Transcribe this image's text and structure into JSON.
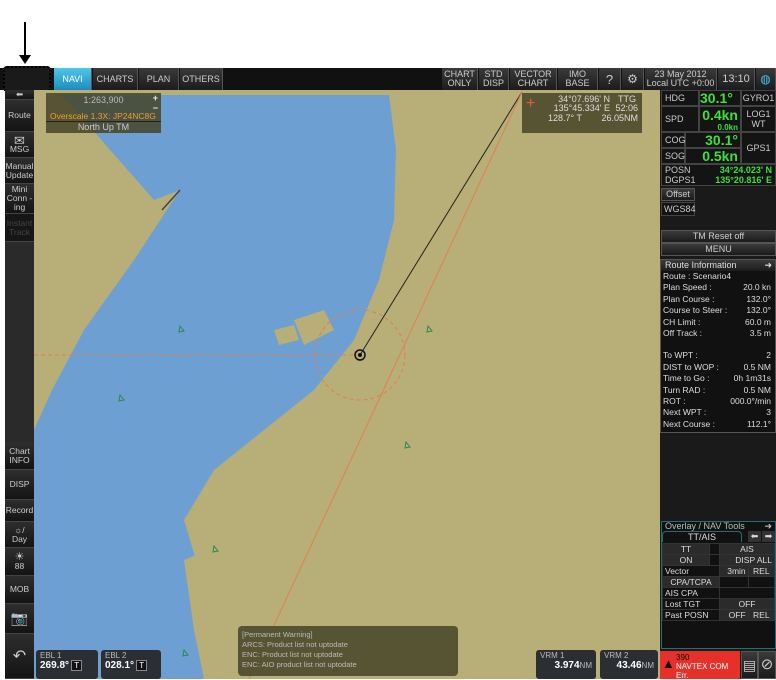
{
  "topbar": {
    "tabs": [
      {
        "label": "NAVI",
        "active": true
      },
      {
        "label": "CHARTS"
      },
      {
        "label": "PLAN"
      },
      {
        "label": "OTHERS"
      }
    ],
    "buttons": [
      {
        "l1": "CHART",
        "l2": "ONLY"
      },
      {
        "l1": "STD",
        "l2": "DISP"
      },
      {
        "l1": "VECTOR",
        "l2": "CHART"
      },
      {
        "l1": "IMO",
        "l2": "BASE"
      }
    ],
    "date": "23 May 2012",
    "utc": "Local UTC +0:00",
    "time": "13:10"
  },
  "sidebar": {
    "items": [
      "Route",
      "MSG",
      "Manual Update",
      "Mini Conn -ing",
      "Instant Track",
      "Chart INFO",
      "DISP",
      "Record",
      "Day",
      "88",
      "MOB"
    ]
  },
  "scale_box": {
    "scale": "1:263,900",
    "overscale": "Overscale 1.3X: JP24NC8G",
    "mode": "North Up TM"
  },
  "cursor_box": {
    "lat": "34°07.696' N",
    "lon": "135°45.334' E",
    "ttg_label": "TTG",
    "ttg": "52:06",
    "brg": "128.7° T",
    "dist": "26.05NM"
  },
  "nav": {
    "hdg_label": "HDG",
    "hdg": "30.1°",
    "hdg_src": "GYRO1",
    "spd_label": "SPD",
    "spd": "0.4kn",
    "spd_sub": "0.0kn",
    "spd_src": "LOG1",
    "spd_src2": "WT",
    "cog_label": "COG",
    "cog": "30.1°",
    "sog_label": "SOG",
    "sog": "0.5kn",
    "cog_src": "GPS1",
    "posn_label": "POSN",
    "posn_src": "DGPS1",
    "lat": "34°24.023' N",
    "lon": "135°20.816' E",
    "offset": "Offset",
    "datum": "WGS84",
    "tm_reset": "TM Reset off",
    "menu": "MENU"
  },
  "route_info": {
    "title": "Route Information",
    "route": "Route :  Scenario4",
    "rows1": [
      [
        "Plan Speed :",
        "20.0 kn"
      ],
      [
        "Plan Course :",
        "132.0°"
      ],
      [
        "Course to Steer :",
        "132.0°"
      ],
      [
        "CH Limit :",
        "60.0 m"
      ],
      [
        "Off Track :",
        "3.5 m"
      ]
    ],
    "rows2": [
      [
        "To WPT :",
        "2"
      ],
      [
        "DIST to WOP :",
        "0.5 NM"
      ],
      [
        "Time to Go :",
        "0h  1m31s"
      ],
      [
        "Turn RAD :",
        "0.5 NM"
      ],
      [
        "ROT :",
        "000.0°/min"
      ],
      [
        "Next WPT :",
        "3"
      ],
      [
        "Next Course :",
        "112.1°"
      ]
    ]
  },
  "overlay": {
    "title": "Overlay / NAV Tools",
    "tab": "TT/AIS",
    "tt": "TT",
    "ais": "AIS",
    "on": "ON",
    "disp_all": "DISP ALL",
    "vector": "Vector",
    "vector_time": "3min",
    "vector_mode": "REL",
    "cpa": "CPA/TCPA",
    "ais_cpa": "AIS CPA",
    "lost": "Lost TGT",
    "lost_val": "OFF",
    "past": "Past POSN",
    "past_val": "OFF",
    "past_mode": "REL"
  },
  "alert": {
    "code": "390",
    "text": "NAVTEX COM Err.",
    "color": "#e8302a"
  },
  "ebl": [
    {
      "label": "EBL 1",
      "value": "269.8°",
      "mode": "T"
    },
    {
      "label": "EBL 2",
      "value": "028.1°",
      "mode": "T"
    }
  ],
  "vrm": [
    {
      "label": "VRM 1",
      "value": "3.974",
      "unit": "NM"
    },
    {
      "label": "VRM 2",
      "value": "43.46",
      "unit": "NM"
    }
  ],
  "warning": {
    "lines": [
      "[Permanent Warning]",
      "ARCS: Product list not uptodate",
      "ENC: Product list not uptodate",
      "ENC: AIO product list not uptodate"
    ]
  },
  "colors": {
    "land": "#b7ae78",
    "water": "#6e9fd2",
    "accent": "#1d8cc0",
    "value_green": "#3fe03a"
  }
}
